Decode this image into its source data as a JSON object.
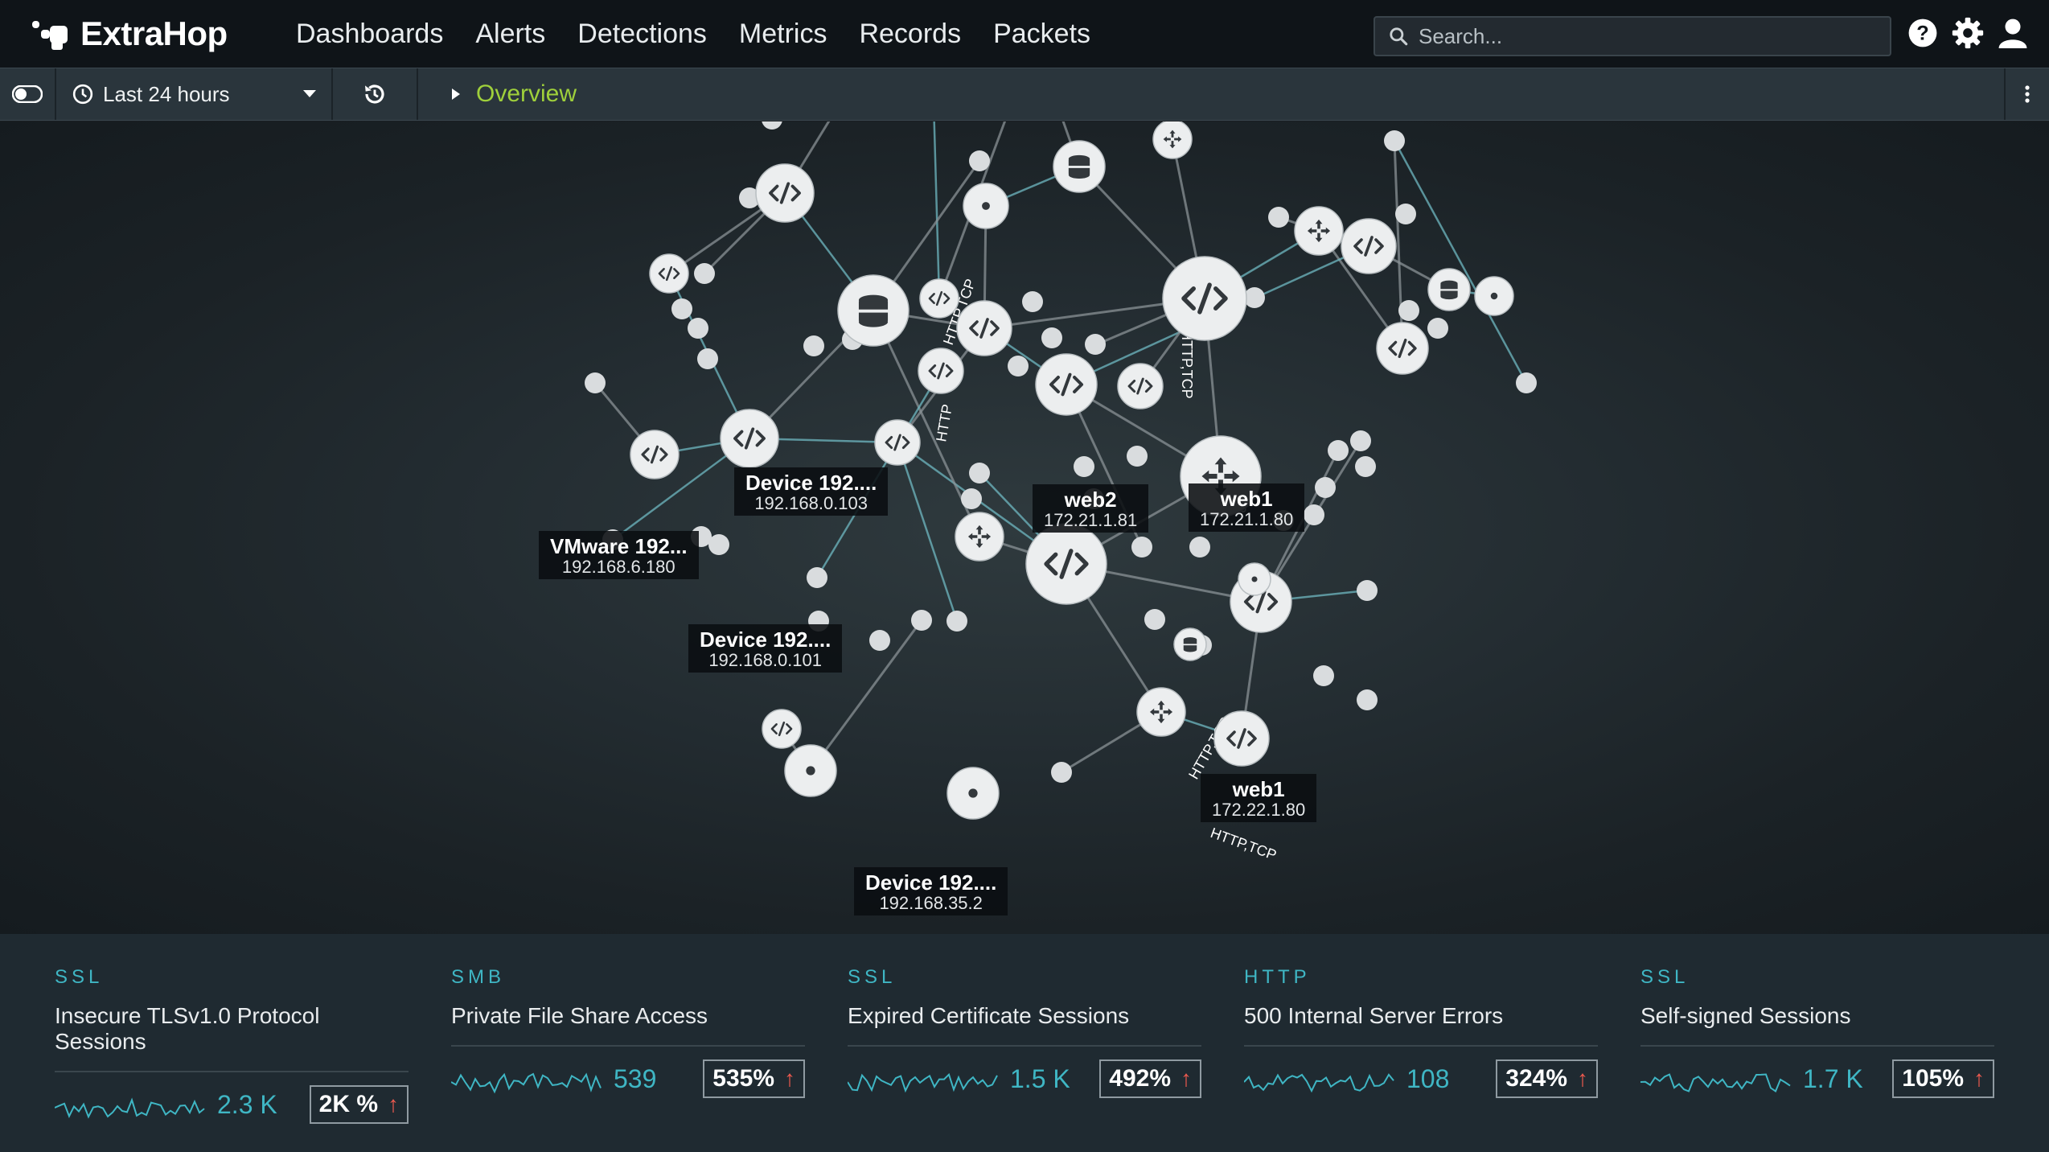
{
  "brand": "ExtraHop",
  "nav": [
    "Dashboards",
    "Alerts",
    "Detections",
    "Metrics",
    "Records",
    "Packets"
  ],
  "search": {
    "placeholder": "Search..."
  },
  "toolbar": {
    "time_range": "Last 24 hours",
    "breadcrumb": "Overview"
  },
  "map": {
    "labels": [
      {
        "name": "Device 192....",
        "ip": "192.168.0.103"
      },
      {
        "name": "VMware 192...",
        "ip": "192.168.6.180"
      },
      {
        "name": "Device 192....",
        "ip": "192.168.0.101"
      },
      {
        "name": "web2",
        "ip": "172.21.1.81"
      },
      {
        "name": "web1",
        "ip": "172.21.1.80"
      },
      {
        "name": "web1",
        "ip": "172.22.1.80"
      },
      {
        "name": "Device 192....",
        "ip": "192.168.35.2"
      }
    ],
    "edge_labels": [
      "HTTP,TCP",
      "HTTP,TCP",
      "HTTP",
      "HTTP,TCP",
      "HTTP,TCP",
      "HTTP,TCP"
    ]
  },
  "metrics": [
    {
      "protocol": "SSL",
      "title": "Insecure TLSv1.0 Protocol Sessions",
      "count": "2.3 K",
      "change": "2K %"
    },
    {
      "protocol": "SMB",
      "title": "Private File Share Access",
      "count": "539",
      "change": "535%"
    },
    {
      "protocol": "SSL",
      "title": "Expired Certificate Sessions",
      "count": "1.5 K",
      "change": "492%"
    },
    {
      "protocol": "HTTP",
      "title": "500 Internal Server Errors",
      "count": "108",
      "change": "324%"
    },
    {
      "protocol": "SSL",
      "title": "Self-signed Sessions",
      "count": "1.7 K",
      "change": "105%"
    }
  ],
  "colors": {
    "accent_green": "#9fd03b",
    "accent_teal": "#3fb6c4",
    "alert_red": "#f05a4f"
  },
  "icons": [
    "search-icon",
    "help-icon",
    "gear-icon",
    "user-icon",
    "clock-icon",
    "history-icon",
    "chevron-down-icon",
    "play-icon",
    "more-vertical-icon",
    "up-arrow-icon"
  ]
}
